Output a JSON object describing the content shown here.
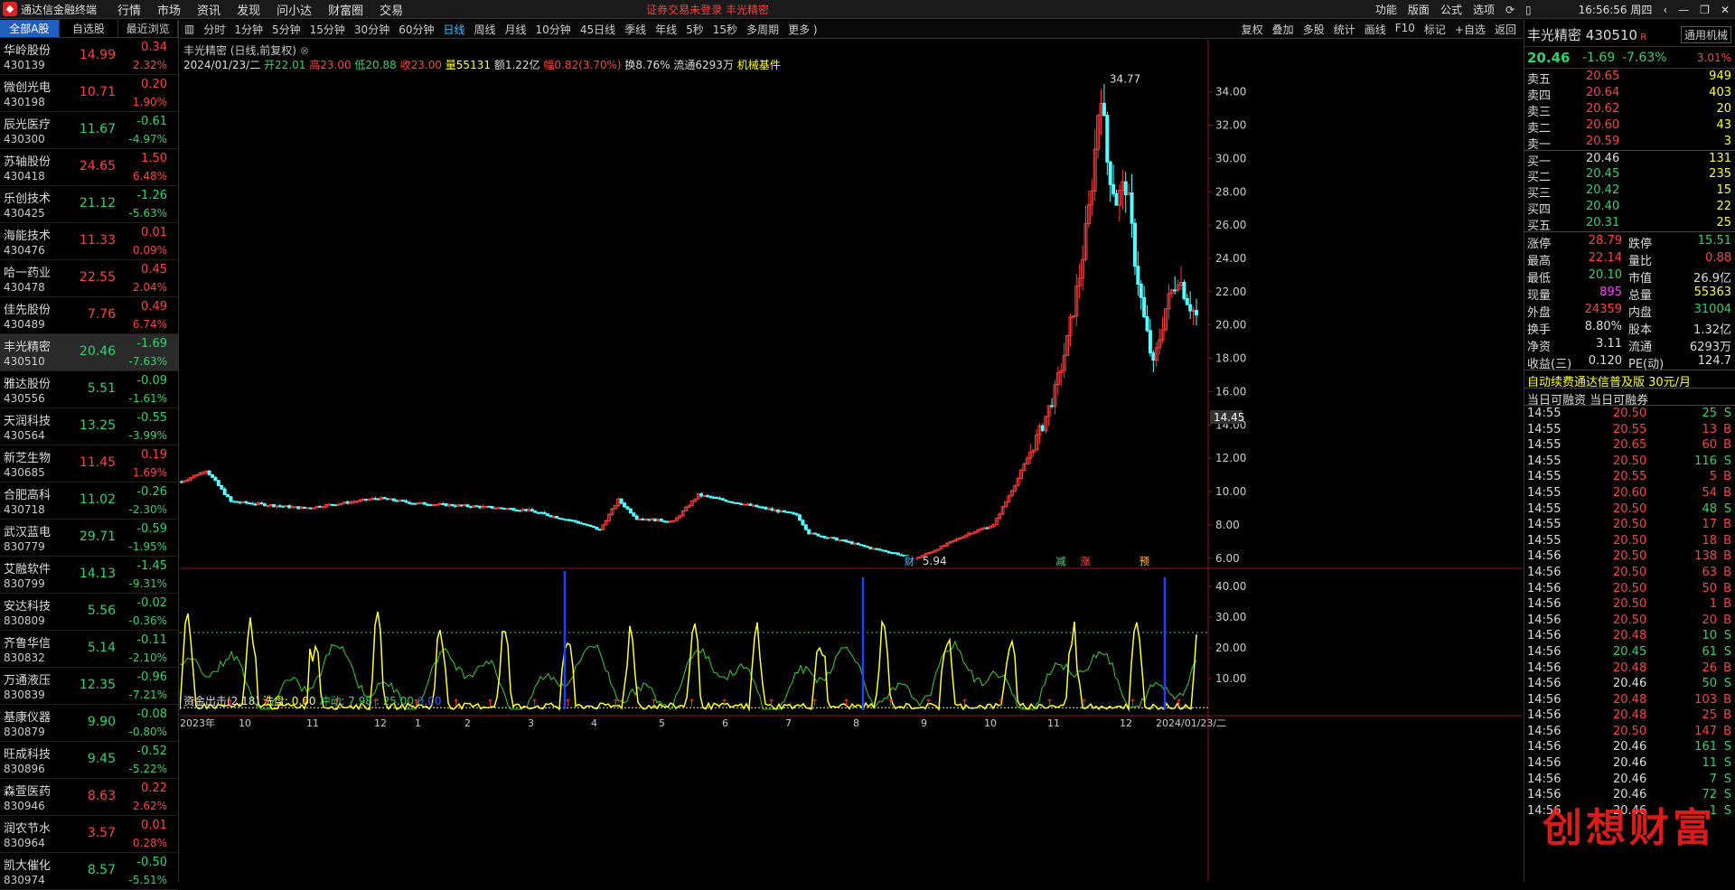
{
  "app": {
    "title": "通达信金融终端",
    "menus": [
      "行情",
      "市场",
      "资讯",
      "发现",
      "问小达",
      "财富圈",
      "交易"
    ],
    "alert": "证券交易未登录   丰光精密",
    "right": [
      "功能",
      "版面",
      "公式",
      "选项"
    ],
    "time": "16:56:56 周四"
  },
  "left": {
    "tabs": [
      "全部A股",
      "自选股",
      "最近浏览"
    ],
    "stocks": [
      {
        "name": "华岭股份",
        "code": "430139",
        "price": "14.99",
        "change": "0.34",
        "pct": "2.32%",
        "dir": "up"
      },
      {
        "name": "微创光电",
        "code": "430198",
        "price": "10.71",
        "change": "0.20",
        "pct": "1.90%",
        "dir": "up"
      },
      {
        "name": "辰光医疗",
        "code": "430300",
        "price": "11.67",
        "change": "-0.61",
        "pct": "-4.97%",
        "dir": "dn"
      },
      {
        "name": "苏轴股份",
        "code": "430418",
        "price": "24.65",
        "change": "1.50",
        "pct": "6.48%",
        "dir": "up"
      },
      {
        "name": "乐创技术",
        "code": "430425",
        "price": "21.12",
        "change": "-1.26",
        "pct": "-5.63%",
        "dir": "dn"
      },
      {
        "name": "海能技术",
        "code": "430476",
        "price": "11.33",
        "change": "0.01",
        "pct": "0.09%",
        "dir": "up"
      },
      {
        "name": "哈一药业",
        "code": "430478",
        "price": "22.55",
        "change": "0.45",
        "pct": "2.04%",
        "dir": "up"
      },
      {
        "name": "佳先股份",
        "code": "430489",
        "price": "7.76",
        "change": "0.49",
        "pct": "6.74%",
        "dir": "up"
      },
      {
        "name": "丰光精密",
        "code": "430510",
        "price": "20.46",
        "change": "-1.69",
        "pct": "-7.63%",
        "dir": "dn",
        "sel": true
      },
      {
        "name": "雅达股份",
        "code": "430556",
        "price": "5.51",
        "change": "-0.09",
        "pct": "-1.61%",
        "dir": "dn"
      },
      {
        "name": "天润科技",
        "code": "430564",
        "price": "13.25",
        "change": "-0.55",
        "pct": "-3.99%",
        "dir": "dn"
      },
      {
        "name": "新芝生物",
        "code": "430685",
        "price": "11.45",
        "change": "0.19",
        "pct": "1.69%",
        "dir": "up"
      },
      {
        "name": "合肥高科",
        "code": "430718",
        "price": "11.02",
        "change": "-0.26",
        "pct": "-2.30%",
        "dir": "dn"
      },
      {
        "name": "武汉蓝电",
        "code": "830779",
        "price": "29.71",
        "change": "-0.59",
        "pct": "-1.95%",
        "dir": "dn"
      },
      {
        "name": "艾融软件",
        "code": "830799",
        "price": "14.13",
        "change": "-1.45",
        "pct": "-9.31%",
        "dir": "dn"
      },
      {
        "name": "安达科技",
        "code": "830809",
        "price": "5.56",
        "change": "-0.02",
        "pct": "-0.36%",
        "dir": "dn"
      },
      {
        "name": "齐鲁华信",
        "code": "830832",
        "price": "5.14",
        "change": "-0.11",
        "pct": "-2.10%",
        "dir": "dn"
      },
      {
        "name": "万通液压",
        "code": "830839",
        "price": "12.35",
        "change": "-0.96",
        "pct": "-7.21%",
        "dir": "dn"
      },
      {
        "name": "基康仪器",
        "code": "830879",
        "price": "9.90",
        "change": "-0.08",
        "pct": "-0.80%",
        "dir": "dn"
      },
      {
        "name": "旺成科技",
        "code": "830896",
        "price": "9.45",
        "change": "-0.52",
        "pct": "-5.22%",
        "dir": "dn"
      },
      {
        "name": "森萱医药",
        "code": "830946",
        "price": "8.63",
        "change": "0.22",
        "pct": "2.62%",
        "dir": "up"
      },
      {
        "name": "润农节水",
        "code": "830964",
        "price": "3.57",
        "change": "0.01",
        "pct": "0.28%",
        "dir": "up"
      },
      {
        "name": "凯大催化",
        "code": "830974",
        "price": "8.57",
        "change": "-0.50",
        "pct": "-5.51%",
        "dir": "dn"
      }
    ]
  },
  "toolbar": {
    "periods": [
      "分时",
      "1分钟",
      "5分钟",
      "15分钟",
      "30分钟",
      "60分钟",
      "日线",
      "周线",
      "月线",
      "10分钟",
      "45日线",
      "季线",
      "年线",
      "5秒",
      "15秒",
      "多周期",
      "更多 )"
    ],
    "active": "日线",
    "right": [
      "复权",
      "叠加",
      "多股",
      "统计",
      "画线",
      "F10",
      "标记",
      "+自选",
      "返回"
    ]
  },
  "chart": {
    "title": "丰光精密 (日线,前复权)",
    "date": "2024/01/23/二",
    "open": "开22.01",
    "high": "高23.00",
    "low": "低20.88",
    "close": "收23.00",
    "vol": "量55131",
    "amt": "额1.22亿",
    "amp": "幅0.82(3.70%)",
    "turn": "换8.76%",
    "float": "流通6293万",
    "sector": "机械基件",
    "max_label": "34.77",
    "min_label": "5.94",
    "price_tag": "14.45",
    "markers": [
      "财",
      "减",
      "涨",
      "预"
    ],
    "indicator": {
      "name": "资金出击(2,18)",
      "wash": "洗盘: 0.00",
      "impulse": "冲动: 7.98 : 25.00",
      "extra": "0.00"
    },
    "xlabels": [
      "2023年",
      "10",
      "11",
      "12",
      "1",
      "2",
      "3",
      "4",
      "5",
      "6",
      "7",
      "8",
      "9",
      "10",
      "11",
      "12",
      "2024/01/23/二"
    ],
    "weekday": "日线"
  },
  "chart_data": {
    "type": "candlestick",
    "ylim": [
      5.5,
      35.5
    ],
    "yticks": [
      "6.00",
      "8.00",
      "10.00",
      "12.00",
      "14.00",
      "16.00",
      "18.00",
      "20.00",
      "22.00",
      "24.00",
      "26.00",
      "28.00",
      "30.00",
      "32.00",
      "34.00"
    ],
    "ind_ylim": [
      0,
      45
    ],
    "ind_yticks": [
      "10.00",
      "20.00",
      "30.00",
      "40.00"
    ]
  },
  "right": {
    "name": "丰光精密",
    "code": "430510",
    "badge": "通用机械",
    "price": "20.46",
    "change": "-1.69",
    "pct": "-7.63%",
    "badge_pct": "3.01%",
    "asks": [
      [
        "卖五",
        "20.65",
        "949"
      ],
      [
        "卖四",
        "20.64",
        "403"
      ],
      [
        "卖三",
        "20.62",
        "20"
      ],
      [
        "卖二",
        "20.60",
        "43"
      ],
      [
        "卖一",
        "20.59",
        "3"
      ]
    ],
    "bids": [
      [
        "买一",
        "20.46",
        "131"
      ],
      [
        "买二",
        "20.45",
        "235"
      ],
      [
        "买三",
        "20.42",
        "15"
      ],
      [
        "买四",
        "20.40",
        "22"
      ],
      [
        "买五",
        "20.31",
        "25"
      ]
    ],
    "stats": [
      [
        "涨停",
        "28.79",
        "跌停",
        "15.51"
      ],
      [
        "最高",
        "22.14",
        "量比",
        "0.88"
      ],
      [
        "最低",
        "20.10",
        "市值",
        "26.9亿"
      ],
      [
        "现量",
        "895",
        "总量",
        "55363"
      ],
      [
        "外盘",
        "24359",
        "内盘",
        "31004"
      ],
      [
        "换手",
        "8.80%",
        "股本",
        "1.32亿"
      ],
      [
        "净资",
        "3.11",
        "流通",
        "6293万"
      ],
      [
        "收益(三)",
        "0.120",
        "PE(动)",
        "124.7"
      ]
    ],
    "promo": "自动续费通达信普及版  30元/月",
    "margin": "当日可融资 当日可融券",
    "ticks": [
      [
        "14:55",
        "20.50",
        "25",
        "S"
      ],
      [
        "14:55",
        "20.55",
        "13",
        "B"
      ],
      [
        "14:55",
        "20.65",
        "60",
        "B"
      ],
      [
        "14:55",
        "20.50",
        "116",
        "S"
      ],
      [
        "14:55",
        "20.55",
        "5",
        "B"
      ],
      [
        "14:55",
        "20.60",
        "54",
        "B"
      ],
      [
        "14:55",
        "20.50",
        "48",
        "S"
      ],
      [
        "14:55",
        "20.50",
        "17",
        "B"
      ],
      [
        "14:55",
        "20.50",
        "18",
        "B"
      ],
      [
        "14:56",
        "20.50",
        "138",
        "B"
      ],
      [
        "14:56",
        "20.50",
        "63",
        "B"
      ],
      [
        "14:56",
        "20.50",
        "50",
        "B"
      ],
      [
        "14:56",
        "20.50",
        "1",
        "B"
      ],
      [
        "14:56",
        "20.50",
        "20",
        "B"
      ],
      [
        "14:56",
        "20.48",
        "10",
        "S"
      ],
      [
        "14:56",
        "20.45",
        "61",
        "S"
      ],
      [
        "14:56",
        "20.48",
        "26",
        "B"
      ],
      [
        "14:56",
        "20.46",
        "50",
        "S"
      ],
      [
        "14:56",
        "20.48",
        "103",
        "B"
      ],
      [
        "14:56",
        "20.48",
        "25",
        "B"
      ],
      [
        "14:56",
        "20.50",
        "147",
        "B"
      ],
      [
        "14:56",
        "20.46",
        "161",
        "S"
      ],
      [
        "14:56",
        "20.46",
        "11",
        "S"
      ],
      [
        "14:56",
        "20.46",
        "7",
        "S"
      ],
      [
        "14:56",
        "20.46",
        "72",
        "S"
      ],
      [
        "14:56",
        "20.46",
        "1",
        "S"
      ]
    ]
  },
  "watermark": "创想财富"
}
